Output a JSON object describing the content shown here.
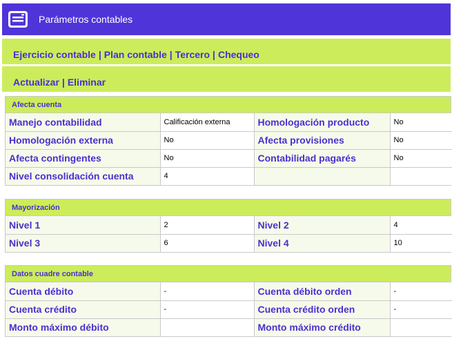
{
  "header": {
    "title": "Parámetros contables",
    "icon": "window-panel-icon"
  },
  "nav": {
    "items": [
      "Ejercicio contable",
      "Plan contable",
      "Tercero",
      "Chequeo"
    ],
    "actions": [
      "Actualizar",
      "Eliminar"
    ],
    "separator": "|"
  },
  "sections": {
    "afecta": {
      "title": "Afecta cuenta",
      "rows": [
        {
          "l1": "Manejo contabilidad",
          "v1": "Calificación externa",
          "l2": "Homologación producto",
          "v2": "No"
        },
        {
          "l1": "Homologación externa",
          "v1": "No",
          "l2": "Afecta provisiones",
          "v2": "No"
        },
        {
          "l1": "Afecta contingentes",
          "v1": "No",
          "l2": "Contabilidad pagarés",
          "v2": "No"
        },
        {
          "l1": "Nivel consolidación cuenta",
          "v1": "4",
          "l2": "",
          "v2": ""
        }
      ]
    },
    "mayorizacion": {
      "title": "Mayorización",
      "rows": [
        {
          "l1": "Nivel 1",
          "v1": "2",
          "l2": "Nivel 2",
          "v2": "4"
        },
        {
          "l1": "Nivel 3",
          "v1": "6",
          "l2": "Nivel 4",
          "v2": "10"
        }
      ]
    },
    "cuadre": {
      "title": "Datos cuadre contable",
      "rows": [
        {
          "l1": "Cuenta débito",
          "v1": "-",
          "l2": "Cuenta débito orden",
          "v2": "-"
        },
        {
          "l1": "Cuenta crédito",
          "v1": "-",
          "l2": "Cuenta crédito orden",
          "v2": "-"
        },
        {
          "l1": "Monto máximo débito",
          "v1": "",
          "l2": "Monto máximo crédito",
          "v2": ""
        }
      ]
    }
  },
  "colors": {
    "header_bg": "#4f35d9",
    "bar_bg": "#ccec5c",
    "label_text": "#4a2fd0",
    "label_bg": "#f6faea"
  }
}
